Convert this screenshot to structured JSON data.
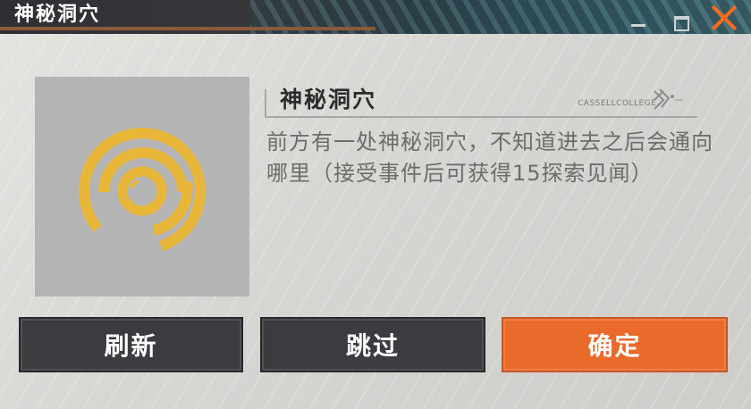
{
  "window": {
    "title": "神秘洞穴",
    "accent_color": "#ff6a1a",
    "controls": [
      "minimize-icon",
      "maximize-icon",
      "close-icon"
    ]
  },
  "event": {
    "icon": "target-icon",
    "icon_color": "#e8b73a",
    "title": "神秘洞穴",
    "brand": "CASSELLCOLLEGE",
    "description": "前方有一处神秘洞穴，不知道进去之后会通向哪里（接受事件后可获得15探索见闻）"
  },
  "buttons": {
    "refresh": "刷新",
    "skip": "跳过",
    "confirm": "确定"
  },
  "colors": {
    "confirm_button": "#ea6a2c",
    "dark_button": "#3b3c40"
  }
}
